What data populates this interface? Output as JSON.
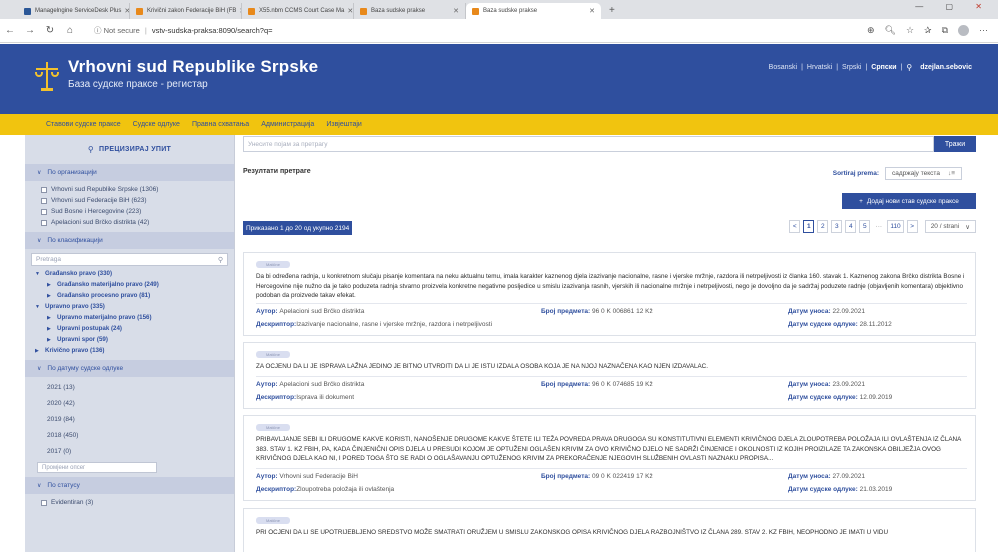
{
  "browser": {
    "tabs": [
      {
        "label": "Managelngine ServiceDesk Plus",
        "fav": "blue"
      },
      {
        "label": "Krivični zakon Federacije BiH (FB",
        "fav": "orange"
      },
      {
        "label": "X55.nbm CCMS Court Case Ma",
        "fav": "orange"
      },
      {
        "label": "Baza sudske prakse",
        "fav": "orange"
      },
      {
        "label": "Baza sudske prakse",
        "fav": "orange"
      }
    ],
    "new_tab": "+",
    "back_icon": "←",
    "forward_icon": "→",
    "reload_icon": "↻",
    "home_icon": "⌂",
    "security_label": "ⓘ Not secure",
    "url": "vstv-sudska-praksa:8090/search?q="
  },
  "site": {
    "title": "Vrhovni sud Republike Srpske",
    "subtitle": "База судске праксе - регистар",
    "lang_links": [
      "Bosanski",
      "Hrvatski",
      "Srpski"
    ],
    "lang_current": "Српски",
    "username": "dzejlan.sebovic"
  },
  "menu": [
    "Ставови судске праксе",
    "Судске одлуке",
    "Правна схватања",
    "Администрација",
    "Извјештаји"
  ],
  "sidebar": {
    "header": "ПРЕЦИЗИРАЈ УПИТ",
    "org_title": "По организацији",
    "orgs": [
      "Vrhovni sud Republike Srpske (1306)",
      "Vrhovni sud Federacije BiH (623)",
      "Sud Bosne i Hercegovine (223)",
      "Apelacioni sud Brčko distrikta (42)"
    ],
    "class_title": "По класификацији",
    "class_search_placeholder": "Pretraga",
    "tree": [
      {
        "label": "Građansko pravo (330)",
        "level": 1
      },
      {
        "label": "Građansko materijalno pravo (249)",
        "level": 2
      },
      {
        "label": "Građansko procesno pravo (81)",
        "level": 2
      },
      {
        "label": "Upravno pravo (335)",
        "level": 1
      },
      {
        "label": "Upravno materijalno pravo (156)",
        "level": 2
      },
      {
        "label": "Upravni postupak (24)",
        "level": 2
      },
      {
        "label": "Upravni spor (59)",
        "level": 2
      },
      {
        "label": "Krivično pravo (136)",
        "level": 1
      }
    ],
    "date_title": "По датуму судске одлуке",
    "dates": [
      "2021 (13)",
      "2020 (42)",
      "2019 (84)",
      "2018 (450)",
      "2017 (0)"
    ],
    "date_placeholder": "Промјени опсег",
    "status_title": "По статусу",
    "statuses": [
      "Evidentiran (3)"
    ]
  },
  "content": {
    "search_placeholder": "Унесите појам за претрагу",
    "search_button": "Тражи",
    "results_title": "Резултати претраге",
    "sort_label": "Sortiraj prema:",
    "sort_value": "садржају текста",
    "add_button": "Додај нови став судске праксе",
    "shown": "Приказано 1 до 20 од укупно 2194",
    "pages": [
      "1",
      "2",
      "3",
      "4",
      "5",
      "···",
      "110"
    ],
    "per_page": "20 / strani"
  },
  "results": [
    {
      "badge": "Matične",
      "text": "Da bi određena radnja, u konkretnom slučaju pisanje komentara na neku aktualnu temu, imala karakter kaznenog djela izazivanje nacionalne, rasne i vjerske mržnje, razdora ili netrpeljivosti iz članka 160. stavak 1. Kaznenog zakona Brčko distrikta Bosne i Hercegovine nije nužno da je tako poduzeta radnja stvarno proizvela konkretne negativne posljedice u smislu izazivanja rasnih, vjerskih ili nacionalne mržnje i netrpeljivosti, nego je dovoljno da je sadržaj poduzete radnje (objavljenih komentara) objektivno podoban da proizvede takav efekat.",
      "author_label": "Аутор:",
      "author": "Apelacioni sud Brčko distrikta",
      "case_label": "Број предмета:",
      "case": "96 0 K 006861 12 Kž",
      "entry_label": "Датум уноса:",
      "entry": "22.09.2021",
      "desc_label": "Дескриптор:",
      "desc": "Izazivanje nacionalne, rasne i vjerske mržnje, razdora i netrpeljivosti",
      "decision_label": "Датум судске одлуке:",
      "decision": "28.11.2012"
    },
    {
      "badge": "Matične",
      "text": "ZA OCJENU DA LI JE ISPRAVA LAŽNA JEDINO JE BITNO UTVRDITI DA LI JE ISTU IZDALA OSOBA KOJA JE NA NJOJ NAZNAČENA KAO NJEN IZDAVALAC.",
      "author_label": "Аутор:",
      "author": "Apelacioni sud Brčko distrikta",
      "case_label": "Број предмета:",
      "case": "96 0 K 074685 19 Kž",
      "entry_label": "Датум уноса:",
      "entry": "23.09.2021",
      "desc_label": "Дескриптор:",
      "desc": "Isprava ili dokument",
      "decision_label": "Датум судске одлуке:",
      "decision": "12.09.2019"
    },
    {
      "badge": "Matične",
      "text": "PRIBAVLJANJE SEBI ILI DRUGOME KAKVE KORISTI, NANOŠENJE DRUGOME KAKVE ŠTETE ILI TEŽA POVREDA PRAVA DRUGOGA SU KONSTITUTIVNI ELEMENTI KRIVIČNOG DJELA ZLOUPOTREBA POLOŽAJA ILI OVLAŠTENJA IZ ČLANA 383. STAV 1. KZ FBIH, PA, KADA ČINJENIČNI OPIS DJELA U PRESUDI KOJOM JE OPTUŽENI OGLAŠEN KRIVIM ZA OVO KRIVIČNO DJELO NE SADRŽI ČINJENICE I OKOLNOSTI IZ KOJIH PROIZILAZE TA ZAKONSKA OBILJEŽJA OVOG KRIVIČNOG DJELA KAO NI, I PORED TOGA ŠTO SE RADI O OGLAŠAVANJU OPTUŽENOG KRIVIM ZA PREKORAČENJE NJEGOVIH SLUŽBENIH OVLASTI NAZNAKU PROPISA...",
      "author_label": "Аутор:",
      "author": "Vrhovni sud Federacije BiH",
      "case_label": "Број предмета:",
      "case": "09 0 K 022419 17 Kž",
      "entry_label": "Датум уноса:",
      "entry": "27.09.2021",
      "desc_label": "Дескриптор:",
      "desc": "Zloupotreba položaja ili ovlaštenja",
      "decision_label": "Датум судске одлуке:",
      "decision": "21.03.2019"
    },
    {
      "badge": "Matične",
      "text": "PRI OCJENI DA LI SE UPOTRIJEBLJENO SREDSTVO MOŽE SMATRATI ORUŽJEM U SMISLU ZAKONSKOG OPISA KRIVIČNOG DJELA RAZBOJNIŠTVO IZ ČLANA 289. STAV 2. KZ FBIH, NEOPHODNO JE IMATI U VIDU"
    }
  ]
}
